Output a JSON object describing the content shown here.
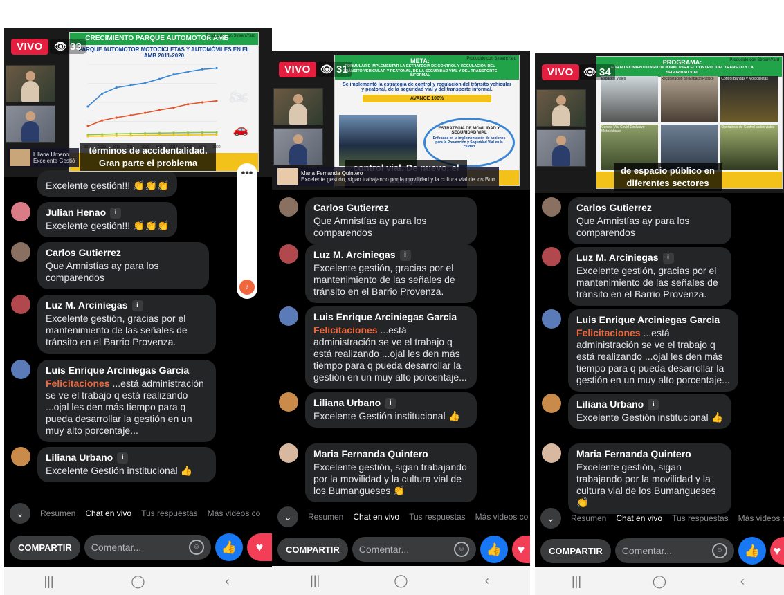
{
  "common": {
    "live_label": "VIVO",
    "tabs": [
      "Resumen",
      "Chat en vivo",
      "Tus respuestas",
      "Más videos co"
    ],
    "share_label": "COMPARTIR",
    "comment_placeholder": "Comentar...",
    "nav": [
      "|||",
      "◯",
      "‹"
    ]
  },
  "screens": [
    {
      "viewers": "33",
      "slide_title": "CRECIMIENTO PARQUE AUTOMOTOR AMB",
      "slide_subtitle": "PARQUE AUTOMOTOR MOTOCICLETAS Y AUTOMÓVILES EN EL AMB 2011-2020",
      "brand": "Producido con StreamYard",
      "caption": "términos de accidentalidad. Gran parte el problema",
      "lower_name": "Liliana Urbano",
      "lower_text": "Excelente Gestión institucional",
      "comments": [
        {
          "name": "",
          "text": "Excelente gestión!!! 👏👏👏"
        },
        {
          "name": "Julian Henao",
          "badge": "i",
          "text": "Excelente gestión!!! 👏👏👏"
        },
        {
          "name": "Carlos Gutierrez",
          "text": "Que Amnistías ay para los comparendos"
        },
        {
          "name": "Luz M. Arciniegas",
          "badge": "i",
          "text": "Excelente gestión, gracias por el mantenimiento de las señales de tránsito en  el Barrio Provenza."
        },
        {
          "name": "Luis Enrique Arciniegas Garcia",
          "highlight": "Felicitaciones",
          "text": " ...está administración se ve el trabajo q está realizando ...ojal les den más tiempo para q pueda desarrollar la gestión en un muy alto porcentaje..."
        },
        {
          "name": "Liliana Urbano",
          "badge": "i",
          "text": "Excelente Gestión institucional 👍"
        }
      ]
    },
    {
      "viewers": "31",
      "slide_title": "META:",
      "slide_subtitle": "FORMULAR E IMPLEMENTAR LA ESTRATEGIA DE CONTROL Y REGULACIÓN DEL TRÁNSITO VEHICULAR Y PEATONAL, DE LA SEGURIDAD VIAL Y DEL TRANSPORTE INFORMAL",
      "slide_body": "Se implementó la estrategia de control y regulación del tránsito vehicular y peatonal, de la seguridad vial y del transporte informal.",
      "slide_progress": "AVANCE 100%",
      "slide_box_title": "ESTRATEGIA DE MOVILIDAD Y SEGURIDAD VIAL",
      "slide_box_text": "Enfocada en la implementación de acciones para la Prevención y Seguridad Vial en la ciudad",
      "brand": "Producido con StreamYard",
      "caption": "control vial. De nuevo, el cumpli",
      "lower_name": "Maria Fernanda Quintero",
      "lower_text": "Excelente gestión, sigan trabajando por la movilidad y la cultura vial de los Bumangueses 👏",
      "comments": [
        {
          "name": "Carlos Gutierrez",
          "text": "Que Amnistías ay para los comparendos"
        },
        {
          "name": "Luz M. Arciniegas",
          "badge": "i",
          "text": "Excelente gestión, gracias por el mantenimiento de las señales de tránsito en  el Barrio Provenza."
        },
        {
          "name": "Luis Enrique Arciniegas Garcia",
          "highlight": "Felicitaciones",
          "text": " ...está administración se ve el trabajo q está realizando ...ojal les den más tiempo para q pueda desarrollar la gestión en un muy alto porcentaje..."
        },
        {
          "name": "Liliana Urbano",
          "badge": "i",
          "text": "Excelente Gestión institucional 👍"
        },
        {
          "name": "Maria Fernanda Quintero",
          "text": "Excelente gestión, sigan trabajando por la movilidad y la cultura vial de los Bumangueses 👏"
        }
      ]
    },
    {
      "viewers": "34",
      "slide_title": "PROGRAMA:",
      "slide_subtitle": "FORTALECIMIENTO INSTITUCIONAL PARA EL CONTROL DEL TRÁNSITO Y LA SEGURIDAD VIAL",
      "slide_tiles": [
        "Espacios Viales",
        "Recuperación del Espacio Público",
        "Control Bandas y Motocicletas",
        "Control Vial Covid Exclusivo Motociclistas",
        "Operativos de Control calles viales"
      ],
      "brand": "Producido con StreamYard",
      "caption": "de espacio público en diferentes sectores",
      "comments": [
        {
          "name": "Carlos Gutierrez",
          "text": "Que Amnistías ay para los comparendos"
        },
        {
          "name": "Luz M. Arciniegas",
          "badge": "i",
          "text": "Excelente gestión, gracias por el mantenimiento de las señales de tránsito en  el Barrio Provenza."
        },
        {
          "name": "Luis Enrique Arciniegas Garcia",
          "highlight": "Felicitaciones",
          "text": " ...está administración se ve el trabajo q está realizando ...ojal les den más tiempo para q pueda desarrollar la gestión en un muy alto porcentaje..."
        },
        {
          "name": "Liliana Urbano",
          "badge": "i",
          "text": "Excelente Gestión institucional 👍"
        },
        {
          "name": "Maria Fernanda Quintero",
          "text": "Excelente gestión, sigan trabajando por la movilidad y la cultura vial de los Bumangueses 👏"
        }
      ]
    }
  ],
  "chart_data": {
    "type": "line",
    "x": [
      "2011",
      "2012",
      "2013",
      "2014",
      "2015",
      "2016",
      "2017",
      "2018",
      "2019",
      "2020"
    ],
    "series": [
      {
        "name": "Motocicletas",
        "color": "#3a86d4",
        "values": [
          357000,
          492000,
          556000,
          580000,
          604000,
          646000,
          693000,
          722000,
          747000,
          760000
        ]
      },
      {
        "name": "Automóviles",
        "color": "#e5532a",
        "values": [
          150000,
          210000,
          240000,
          265000,
          290000,
          320000,
          345000,
          380000,
          400000,
          416000
        ]
      },
      {
        "name": "",
        "color": "#8bc34a",
        "values": [
          60000,
          65000,
          70000,
          72000,
          75000,
          78000,
          80000,
          82000,
          84000,
          85000
        ]
      },
      {
        "name": "",
        "color": "#f2c21a",
        "values": [
          45000,
          47000,
          50000,
          52000,
          54000,
          56000,
          57000,
          58000,
          59000,
          60000
        ]
      }
    ],
    "ylim": [
      0,
      800000
    ]
  }
}
